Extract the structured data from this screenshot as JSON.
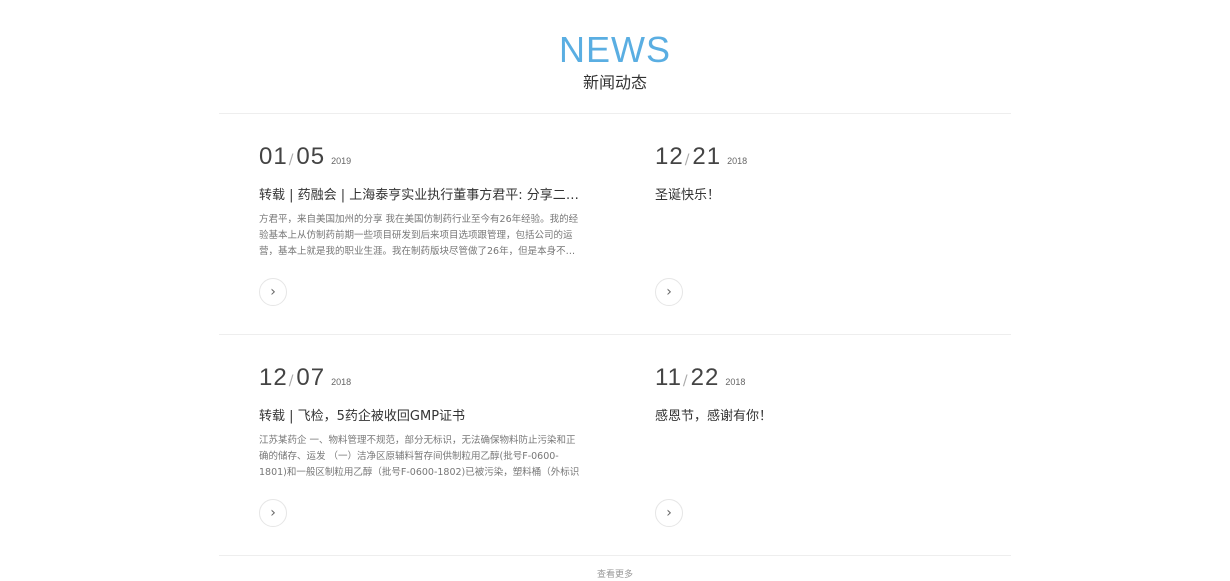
{
  "section": {
    "title_en": "NEWS",
    "title_cn": "新闻动态"
  },
  "news": [
    {
      "month_day_1": "01",
      "month_day_2": "05",
      "sep": "/",
      "year": "2019",
      "title": "转载 | 药融会 | 上海泰亨实业执行董事方君平: 分享二十五年的医药行业经验",
      "excerpt": "方君平，来自美国加州的分享 我在美国仿制药行业至今有26年经验。我的经验基本上从仿制药前期一些项目研发到后来项目选项跟管理，包括公司的运营，基本上就是我的职业生涯。我在制药版块尽管做了26年，但是本身不…",
      "arrow": "›"
    },
    {
      "month_day_1": "12",
      "month_day_2": "21",
      "sep": "/",
      "year": "2018",
      "title": "圣诞快乐！",
      "excerpt": "",
      "arrow": "›"
    },
    {
      "month_day_1": "12",
      "month_day_2": "07",
      "sep": "/",
      "year": "2018",
      "title": "转载 | 飞检，5药企被收回GMP证书",
      "excerpt": "江苏某药企 一、物料管理不规范，部分无标识，无法确保物料防止污染和正确的储存、运发 （一）洁净区原辅料暂存间供制粒用乙醇(批号F-0600-1801)和一般区制粒用乙醇（批号F-0600-1802)已被污染，塑料桶（外标识为\"提取\"…",
      "arrow": "›"
    },
    {
      "month_day_1": "11",
      "month_day_2": "22",
      "sep": "/",
      "year": "2018",
      "title": "感恩节，感谢有你！",
      "excerpt": "",
      "arrow": "›"
    }
  ],
  "footer": {
    "more_label": "查看更多"
  }
}
